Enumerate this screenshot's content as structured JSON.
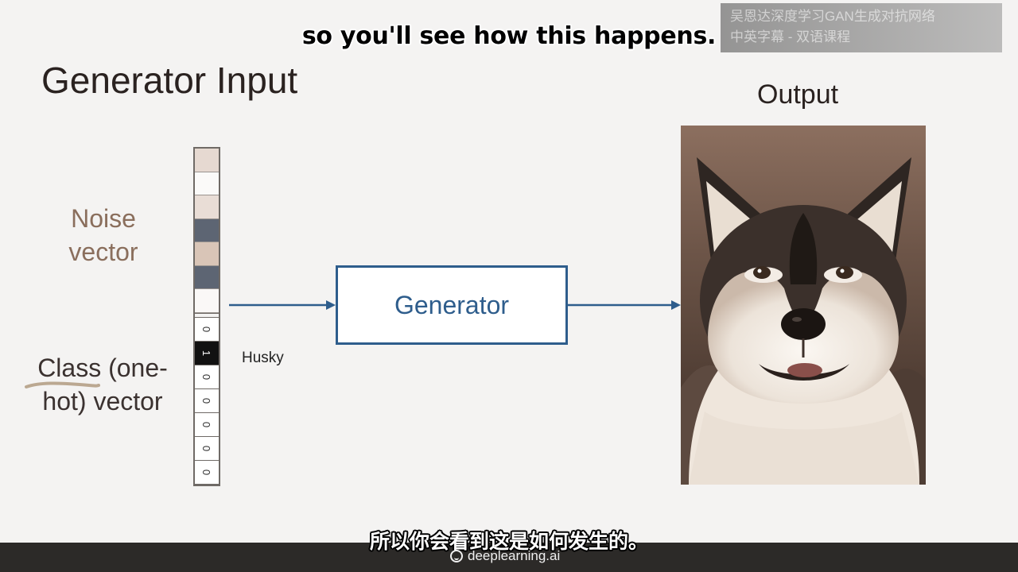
{
  "subtitles": {
    "english": "so you'll see how this happens.",
    "chinese": "所以你会看到这是如何发生的。"
  },
  "watermark": {
    "line1": "吴恩达深度学习GAN生成对抗网络",
    "line2": "中英字幕 - 双语课程"
  },
  "slide": {
    "title": "Generator Input",
    "output_label": "Output",
    "noise_label_line1": "Noise",
    "noise_label_line2": "vector",
    "class_label_line1": "Class (one-",
    "class_label_line2": "hot) vector",
    "class_name": "Husky",
    "generator_label": "Generator",
    "noise_cells": [
      "#e6d9d1",
      "#fbfaf9",
      "#e9ddd6",
      "#5d6573",
      "#d9c5b7",
      "#5d6573",
      "#faf8f7"
    ],
    "one_hot_values": [
      "0",
      "1",
      "0",
      "0",
      "0",
      "0",
      "0"
    ],
    "arrow_color": "#2e5d8c",
    "accent_color": "#2e5d8c"
  },
  "footer": {
    "brand": "deeplearning.ai"
  }
}
